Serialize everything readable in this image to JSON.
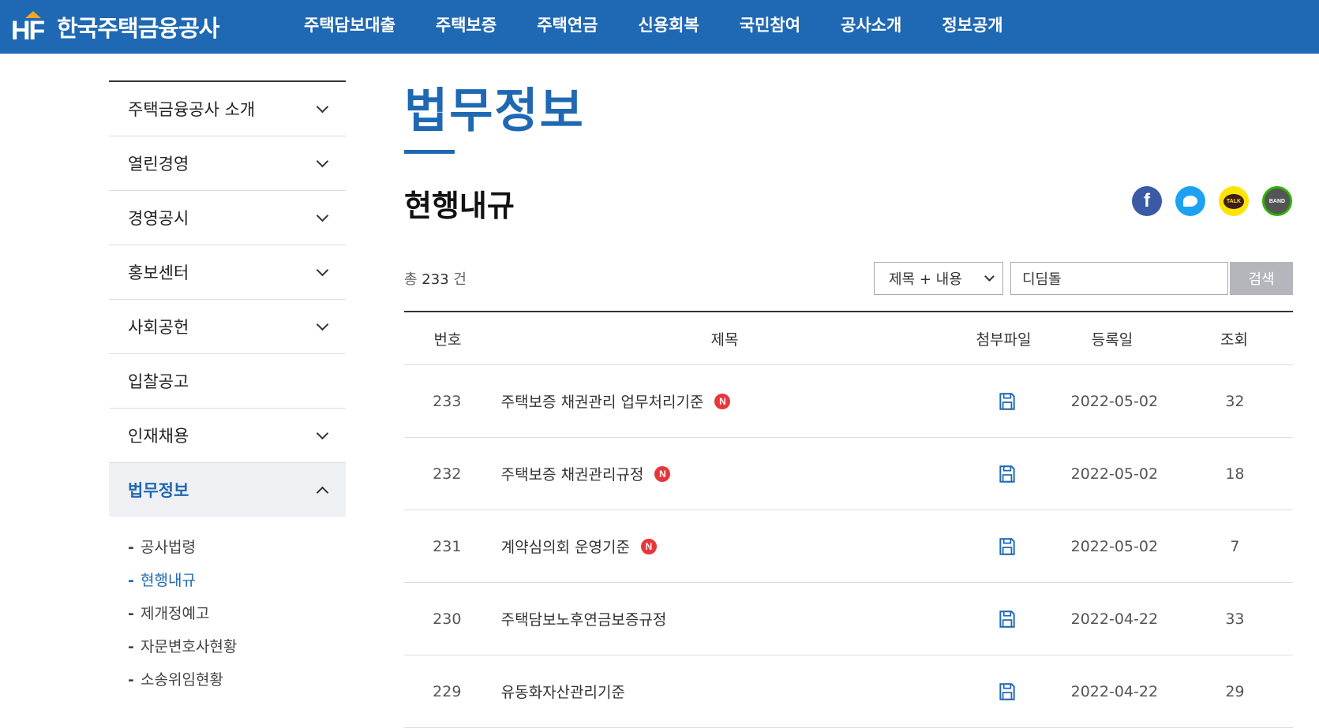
{
  "header": {
    "logo_text": "한국주택금융공사",
    "logo_mark": "HF",
    "menu": [
      "주택담보대출",
      "주택보증",
      "주택연금",
      "신용회복",
      "국민참여",
      "공사소개",
      "정보공개"
    ]
  },
  "lnb": {
    "items": [
      {
        "label": "주택금융공사 소개",
        "chevron": "down"
      },
      {
        "label": "열린경영",
        "chevron": "down"
      },
      {
        "label": "경영공시",
        "chevron": "down"
      },
      {
        "label": "홍보센터",
        "chevron": "down"
      },
      {
        "label": "사회공헌",
        "chevron": "down"
      },
      {
        "label": "입찰공고",
        "chevron": "none"
      },
      {
        "label": "인재채용",
        "chevron": "down"
      },
      {
        "label": "법무정보",
        "chevron": "up",
        "active": true
      }
    ],
    "sub_items": [
      "공사법령",
      "현행내규",
      "제개정예고",
      "자문변호사현황",
      "소송위임현황"
    ],
    "sub_current": "현행내규",
    "dash": "-"
  },
  "content": {
    "page_title": "법무정보",
    "sub_title": "현행내규",
    "sns": {
      "facebook": "f",
      "kakao": "TALK",
      "band": "BAND"
    },
    "total_prefix": "총",
    "total_count": "233",
    "total_suffix": "건",
    "search": {
      "select_value": "제목 + 내용",
      "input_value": "디딤돌",
      "button_label": "검색"
    },
    "table": {
      "headers": {
        "no": "번호",
        "title": "제목",
        "file": "첨부파일",
        "date": "등록일",
        "views": "조회"
      },
      "new_badge": "N",
      "rows": [
        {
          "no": "233",
          "title": "주택보증 채권관리 업무처리기준",
          "is_new": true,
          "date": "2022-05-02",
          "views": "32"
        },
        {
          "no": "232",
          "title": "주택보증 채권관리규정",
          "is_new": true,
          "date": "2022-05-02",
          "views": "18"
        },
        {
          "no": "231",
          "title": "계약심의회 운영기준",
          "is_new": true,
          "date": "2022-05-02",
          "views": "7"
        },
        {
          "no": "230",
          "title": "주택담보노후연금보증규정",
          "is_new": false,
          "date": "2022-04-22",
          "views": "33"
        },
        {
          "no": "229",
          "title": "유동화자산관리기준",
          "is_new": false,
          "date": "2022-04-22",
          "views": "29"
        }
      ]
    }
  },
  "colors": {
    "brand": "#1f68b3",
    "badge": "#e8363b",
    "search_btn": "#b3b6ba"
  }
}
